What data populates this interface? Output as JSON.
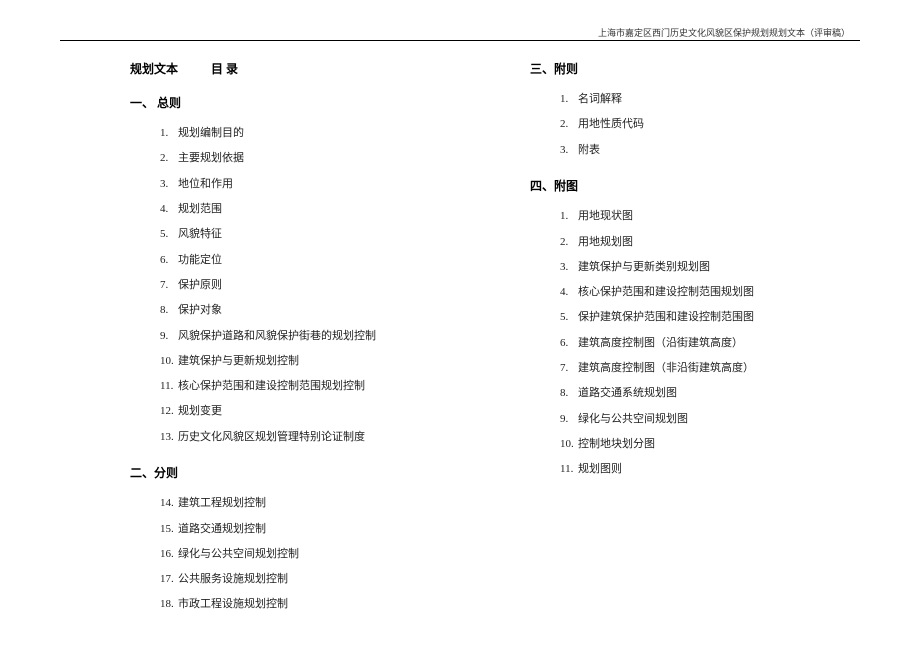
{
  "header": "上海市嘉定区西门历史文化风貌区保护规划规划文本（评审稿）",
  "title_main": "规划文本",
  "title_sub": "目 录",
  "sections": [
    {
      "heading": "一、 总则",
      "items": [
        {
          "num": "1.",
          "text": "规划编制目的"
        },
        {
          "num": "2.",
          "text": "主要规划依据"
        },
        {
          "num": "3.",
          "text": "地位和作用"
        },
        {
          "num": "4.",
          "text": "规划范围"
        },
        {
          "num": "5.",
          "text": "风貌特征"
        },
        {
          "num": "6.",
          "text": "功能定位"
        },
        {
          "num": "7.",
          "text": "保护原则"
        },
        {
          "num": "8.",
          "text": "保护对象"
        },
        {
          "num": "9.",
          "text": "风貌保护道路和风貌保护街巷的规划控制"
        },
        {
          "num": "10.",
          "text": "建筑保护与更新规划控制"
        },
        {
          "num": "11.",
          "text": "核心保护范围和建设控制范围规划控制"
        },
        {
          "num": "12.",
          "text": "规划变更"
        },
        {
          "num": "13.",
          "text": "历史文化风貌区规划管理特别论证制度"
        }
      ]
    },
    {
      "heading": "二、分则",
      "items": [
        {
          "num": "14.",
          "text": "建筑工程规划控制"
        },
        {
          "num": "15.",
          "text": "道路交通规划控制"
        },
        {
          "num": "16.",
          "text": "绿化与公共空间规划控制"
        },
        {
          "num": "17.",
          "text": "公共服务设施规划控制"
        },
        {
          "num": "18.",
          "text": "市政工程设施规划控制"
        }
      ]
    },
    {
      "heading": "三、附则",
      "items": [
        {
          "num": "1.",
          "text": "名词解释"
        },
        {
          "num": "2.",
          "text": "用地性质代码"
        },
        {
          "num": "3.",
          "text": "附表"
        }
      ]
    },
    {
      "heading": "四、附图",
      "items": [
        {
          "num": "1.",
          "text": "用地现状图"
        },
        {
          "num": "2.",
          "text": "用地规划图"
        },
        {
          "num": "3.",
          "text": "建筑保护与更新类别规划图"
        },
        {
          "num": "4.",
          "text": "核心保护范围和建设控制范围规划图"
        },
        {
          "num": "5.",
          "text": "保护建筑保护范围和建设控制范围图"
        },
        {
          "num": "6.",
          "text": "建筑高度控制图（沿街建筑高度）"
        },
        {
          "num": "7.",
          "text": "建筑高度控制图（非沿街建筑高度）"
        },
        {
          "num": "8.",
          "text": "道路交通系统规划图"
        },
        {
          "num": "9.",
          "text": "绿化与公共空间规划图"
        },
        {
          "num": "10.",
          "text": "控制地块划分图"
        },
        {
          "num": "11.",
          "text": "规划图则"
        }
      ]
    }
  ]
}
